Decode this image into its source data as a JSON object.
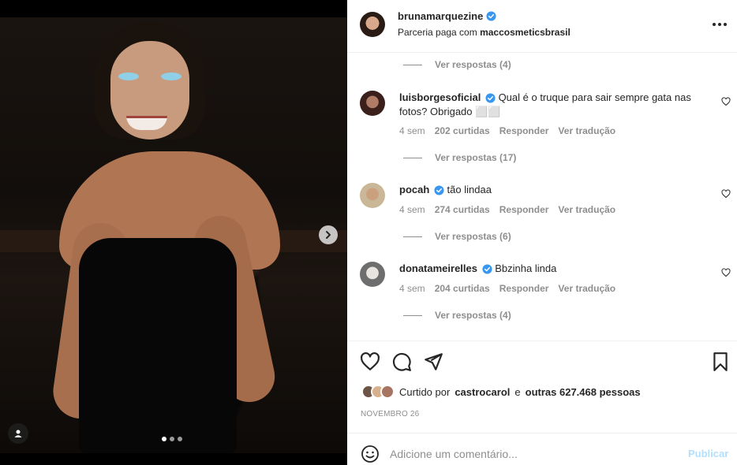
{
  "post": {
    "username": "brunamarquezine",
    "subtitle_prefix": "Parceria paga com",
    "partner": "maccosmeticsbrasil",
    "carousel_pages": 3,
    "carousel_active_index": 0
  },
  "colors": {
    "verified": "#3897f0",
    "text": "#262626",
    "muted": "#8e8e8e",
    "publish_disabled": "#b2dffc"
  },
  "replies_top": {
    "label": "Ver respostas (4)"
  },
  "comments": [
    {
      "username": "luisborgesoficial",
      "text": "Qual é o truque para sair sempre gata nas fotos? Obrigado ⬜⬜",
      "age": "4 sem",
      "likes": "202 curtidas",
      "reply": "Responder",
      "translate": "Ver tradução",
      "view_replies": "Ver respostas (17)"
    },
    {
      "username": "pocah",
      "text": "tão lindaa",
      "age": "4 sem",
      "likes": "274 curtidas",
      "reply": "Responder",
      "translate": "Ver tradução",
      "view_replies": "Ver respostas (6)"
    },
    {
      "username": "donatameirelles",
      "text": "Bbzinha linda",
      "age": "4 sem",
      "likes": "204 curtidas",
      "reply": "Responder",
      "translate": "Ver tradução",
      "view_replies": "Ver respostas (4)"
    }
  ],
  "likes": {
    "prefix": "Curtido por",
    "first_user": "castrocarol",
    "connector": "e",
    "others": "outras 627.468 pessoas"
  },
  "date": "NOVEMBRO 26",
  "comment_box": {
    "placeholder": "Adicione um comentário...",
    "publish_label": "Publicar"
  },
  "icons": {
    "like": "heart-icon",
    "comment": "comment-icon",
    "share": "share-icon",
    "save": "bookmark-icon",
    "emoji": "emoji-icon",
    "next": "chevron-right-icon",
    "tag": "user-tag-icon",
    "more": "more-icon",
    "verified": "verified-badge-icon"
  }
}
